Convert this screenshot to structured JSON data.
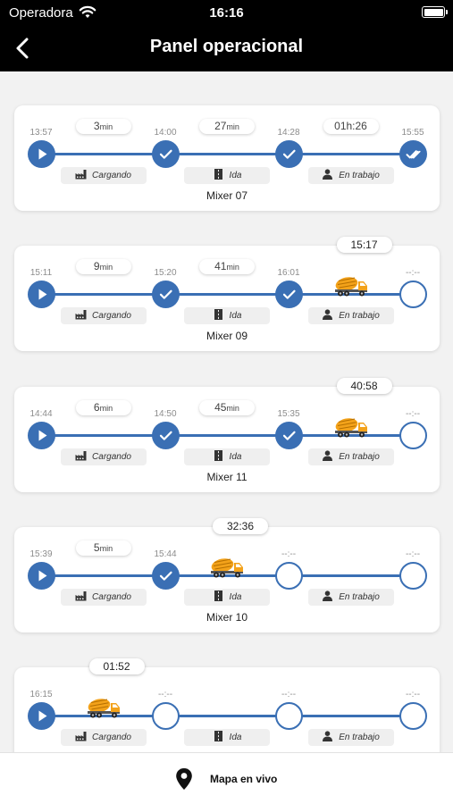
{
  "status_bar": {
    "carrier": "Operadora",
    "time": "16:16"
  },
  "header": {
    "title": "Panel operacional"
  },
  "colors": {
    "accent": "#3a6fb4",
    "truck": "#f3a21a"
  },
  "stage_labels": [
    "Cargando",
    "Ida",
    "En trabajo"
  ],
  "cards": [
    {
      "mixer": "Mixer 07",
      "timer": "",
      "times": [
        "13:57",
        "14:00",
        "14:28",
        "15:55"
      ],
      "durations": [
        {
          "value": "3",
          "unit": "min"
        },
        {
          "value": "27",
          "unit": "min"
        },
        {
          "value": "01h:26",
          "unit": ""
        }
      ],
      "nodes": [
        "play",
        "done",
        "done",
        "final"
      ],
      "truck_index": -1
    },
    {
      "mixer": "Mixer 09",
      "timer": "15:17",
      "times": [
        "15:11",
        "15:20",
        "16:01",
        "--:--"
      ],
      "durations": [
        {
          "value": "9",
          "unit": "min"
        },
        {
          "value": "41",
          "unit": "min"
        }
      ],
      "nodes": [
        "play",
        "done",
        "done",
        "empty"
      ],
      "truck_index": 2
    },
    {
      "mixer": "Mixer 11",
      "timer": "40:58",
      "times": [
        "14:44",
        "14:50",
        "15:35",
        "--:--"
      ],
      "durations": [
        {
          "value": "6",
          "unit": "min"
        },
        {
          "value": "45",
          "unit": "min"
        }
      ],
      "nodes": [
        "play",
        "done",
        "done",
        "empty"
      ],
      "truck_index": 2
    },
    {
      "mixer": "Mixer 10",
      "timer": "32:36",
      "times": [
        "15:39",
        "15:44",
        "--:--",
        "--:--"
      ],
      "durations": [
        {
          "value": "5",
          "unit": "min"
        }
      ],
      "nodes": [
        "play",
        "done",
        "empty",
        "empty"
      ],
      "truck_index": 1
    },
    {
      "mixer": "",
      "timer": "01:52",
      "times": [
        "16:15",
        "--:--",
        "--:--",
        "--:--"
      ],
      "durations": [],
      "nodes": [
        "play",
        "empty",
        "empty",
        "empty"
      ],
      "truck_index": 0
    }
  ],
  "bottom": {
    "label": "Mapa en vivo"
  }
}
